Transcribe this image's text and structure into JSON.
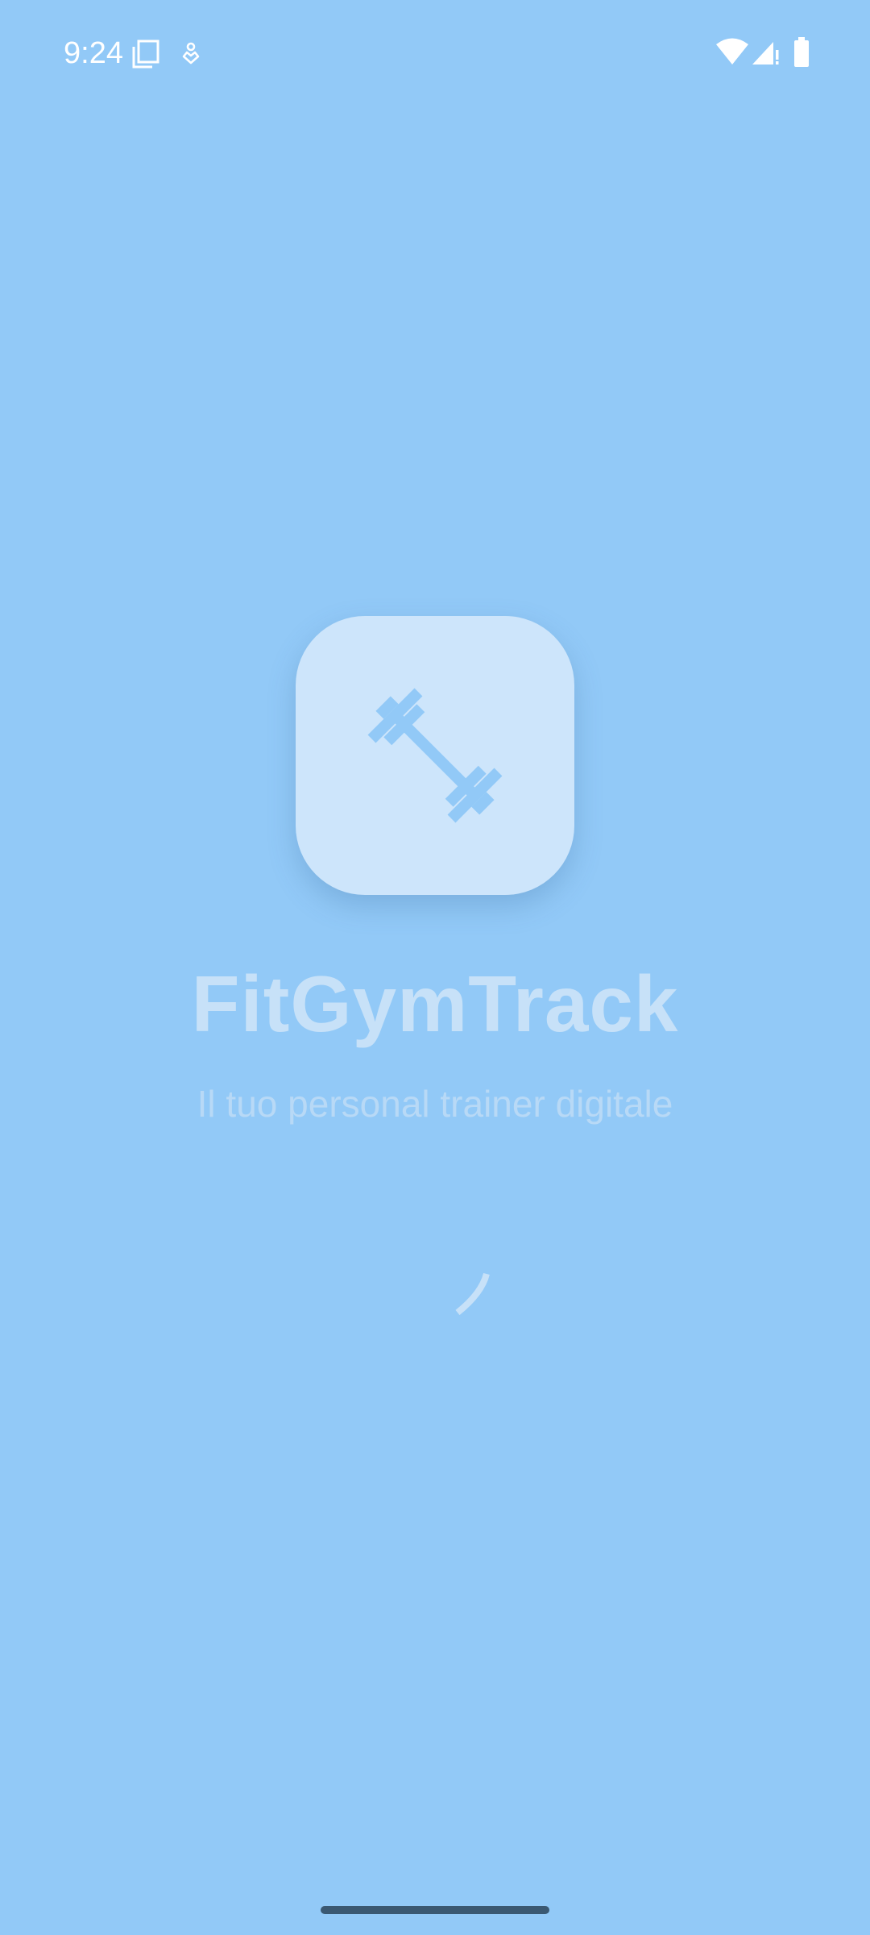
{
  "status_bar": {
    "time": "9:24",
    "left_icons": [
      "screen-icon",
      "notification-icon"
    ],
    "right_icons": [
      "wifi-icon",
      "signal-icon",
      "battery-icon"
    ]
  },
  "splash": {
    "logo_icon": "dumbbell-icon",
    "app_name": "FitGymTrack",
    "tagline": "Il tuo personal trainer digitale",
    "loading_indicator": "spinner"
  },
  "colors": {
    "background": "#92c9f7",
    "card": "#cde5fb",
    "icon": "#92c9f7",
    "title": "#c7e1f8",
    "subtitle": "#b8d9f6",
    "home_indicator": "#3a5872"
  }
}
